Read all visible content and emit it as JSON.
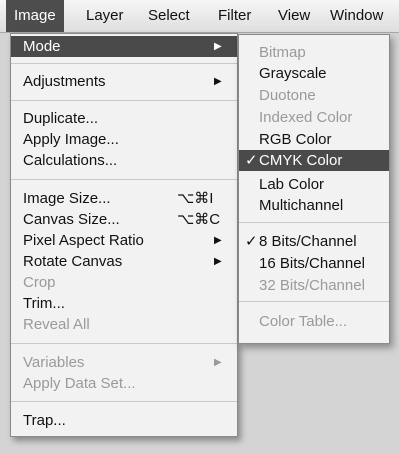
{
  "menubar": [
    "Image",
    "Layer",
    "Select",
    "Filter",
    "View",
    "Window"
  ],
  "image_menu": {
    "mode": "Mode",
    "adjustments": "Adjustments",
    "duplicate": "Duplicate...",
    "apply_image": "Apply Image...",
    "calculations": "Calculations...",
    "image_size": "Image Size...",
    "image_size_shortcut": "⌥⌘I",
    "canvas_size": "Canvas Size...",
    "canvas_size_shortcut": "⌥⌘C",
    "pixel_aspect_ratio": "Pixel Aspect Ratio",
    "rotate_canvas": "Rotate Canvas",
    "crop": "Crop",
    "trim": "Trim...",
    "reveal_all": "Reveal All",
    "variables": "Variables",
    "apply_data_set": "Apply Data Set...",
    "trap": "Trap..."
  },
  "mode_submenu": {
    "bitmap": "Bitmap",
    "grayscale": "Grayscale",
    "duotone": "Duotone",
    "indexed_color": "Indexed Color",
    "rgb_color": "RGB Color",
    "cmyk_color": "CMYK Color",
    "lab_color": "Lab Color",
    "multichannel": "Multichannel",
    "bits8": "8 Bits/Channel",
    "bits16": "16 Bits/Channel",
    "bits32": "32 Bits/Channel",
    "color_table": "Color Table...",
    "checkmark": "✓"
  },
  "icons": {
    "submenu_arrow": "▶"
  }
}
